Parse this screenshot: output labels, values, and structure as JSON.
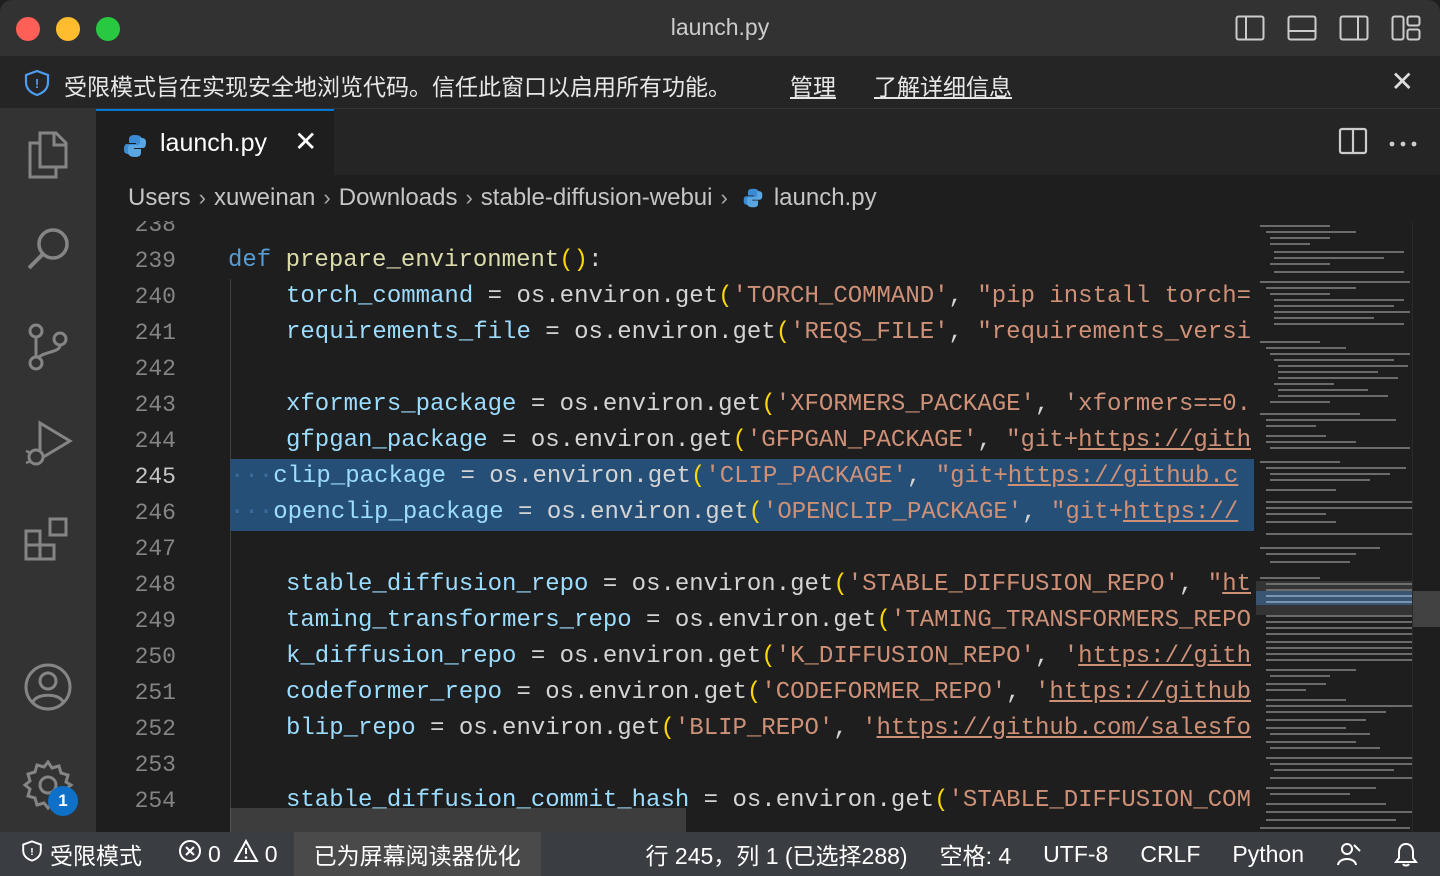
{
  "window": {
    "title": "launch.py"
  },
  "banner": {
    "message": "受限模式旨在实现安全地浏览代码。信任此窗口以启用所有功能。",
    "manage_link": "管理",
    "learn_more_link": "了解详细信息",
    "close": "✕"
  },
  "activity_bar": {
    "items": [
      "explorer-icon",
      "search-icon",
      "source-control-icon",
      "run-debug-icon",
      "extensions-icon",
      "accounts-icon",
      "manage-gear-icon"
    ],
    "settings_badge": "1"
  },
  "tab": {
    "label": "launch.py",
    "close": "✕"
  },
  "breadcrumb": [
    "Users",
    "xuweinan",
    "Downloads",
    "stable-diffusion-webui",
    "launch.py"
  ],
  "editor": {
    "partial_top_line": "238",
    "active_line": "245",
    "lines": [
      {
        "n": "239"
      },
      {
        "n": "240"
      },
      {
        "n": "241"
      },
      {
        "n": "242"
      },
      {
        "n": "243"
      },
      {
        "n": "244"
      },
      {
        "n": "245"
      },
      {
        "n": "246"
      },
      {
        "n": "247"
      },
      {
        "n": "248"
      },
      {
        "n": "249"
      },
      {
        "n": "250"
      },
      {
        "n": "251"
      },
      {
        "n": "252"
      },
      {
        "n": "253"
      },
      {
        "n": "254"
      }
    ],
    "code": {
      "l239": {
        "kw": "def",
        "fn": "prepare_environment",
        "paren": "()",
        "colon": ":"
      },
      "l240": {
        "var": "torch_command",
        "eq": " = ",
        "call": "os.environ.get",
        "open": "(",
        "key": "'TORCH_COMMAND'",
        "comma": ", ",
        "val": "\"pip install torch="
      },
      "l241": {
        "var": "requirements_file",
        "eq": " = ",
        "call": "os.environ.get",
        "open": "(",
        "key": "'REQS_FILE'",
        "comma": ", ",
        "val": "\"requirements_versi"
      },
      "l243": {
        "var": "xformers_package",
        "eq": " = ",
        "call": "os.environ.get",
        "open": "(",
        "key": "'XFORMERS_PACKAGE'",
        "comma": ", ",
        "val": "'xformers==0."
      },
      "l244": {
        "var": "gfpgan_package",
        "eq": " = ",
        "call": "os.environ.get",
        "open": "(",
        "key": "'GFPGAN_PACKAGE'",
        "comma": ", ",
        "val_pre": "\"git+",
        "val_link": "https://gith"
      },
      "l245": {
        "var": "clip_package",
        "eq": " = ",
        "call": "os.environ.get",
        "open": "(",
        "key": "'CLIP_PACKAGE'",
        "comma": ", ",
        "val_pre": "\"git+",
        "val_link": "https://github.c"
      },
      "l246": {
        "var": "openclip_package",
        "eq": " = ",
        "call": "os.environ.get",
        "open": "(",
        "key": "'OPENCLIP_PACKAGE'",
        "comma": ", ",
        "val_pre": "\"git+",
        "val_link": "https://"
      },
      "l248": {
        "var": "stable_diffusion_repo",
        "eq": " = ",
        "call": "os.environ.get",
        "open": "(",
        "key": "'STABLE_DIFFUSION_REPO'",
        "comma": ", ",
        "val_pre": "\"",
        "val_link": "ht"
      },
      "l249": {
        "var": "taming_transformers_repo",
        "eq": " = ",
        "call": "os.environ.get",
        "open": "(",
        "key": "'TAMING_TRANSFORMERS_REPO"
      },
      "l250": {
        "var": "k_diffusion_repo",
        "eq": " = ",
        "call": "os.environ.get",
        "open": "(",
        "key": "'K_DIFFUSION_REPO'",
        "comma": ", ",
        "val_pre": "'",
        "val_link": "https://gith"
      },
      "l251": {
        "var": "codeformer_repo",
        "eq": " = ",
        "call": "os.environ.get",
        "open": "(",
        "key": "'CODEFORMER_REPO'",
        "comma": ", ",
        "val_pre": "'",
        "val_link": "https://github"
      },
      "l252": {
        "var": "blip_repo",
        "eq": " = ",
        "call": "os.environ.get",
        "open": "(",
        "key": "'BLIP_REPO'",
        "comma": ", ",
        "val_pre": "'",
        "val_link": "https://github.com/salesfo"
      },
      "l254": {
        "var": "stable_diffusion_commit_hash",
        "eq": " = ",
        "call": "os.environ.get",
        "open": "(",
        "key": "'STABLE_DIFFUSION_COM"
      }
    }
  },
  "status_bar": {
    "restricted_mode": "受限模式",
    "errors": "0",
    "warnings": "0",
    "screen_reader": "已为屏幕阅读器优化",
    "cursor": "行 245，列 1 (已选择288)",
    "spaces": "空格: 4",
    "encoding": "UTF-8",
    "eol": "CRLF",
    "language": "Python"
  }
}
